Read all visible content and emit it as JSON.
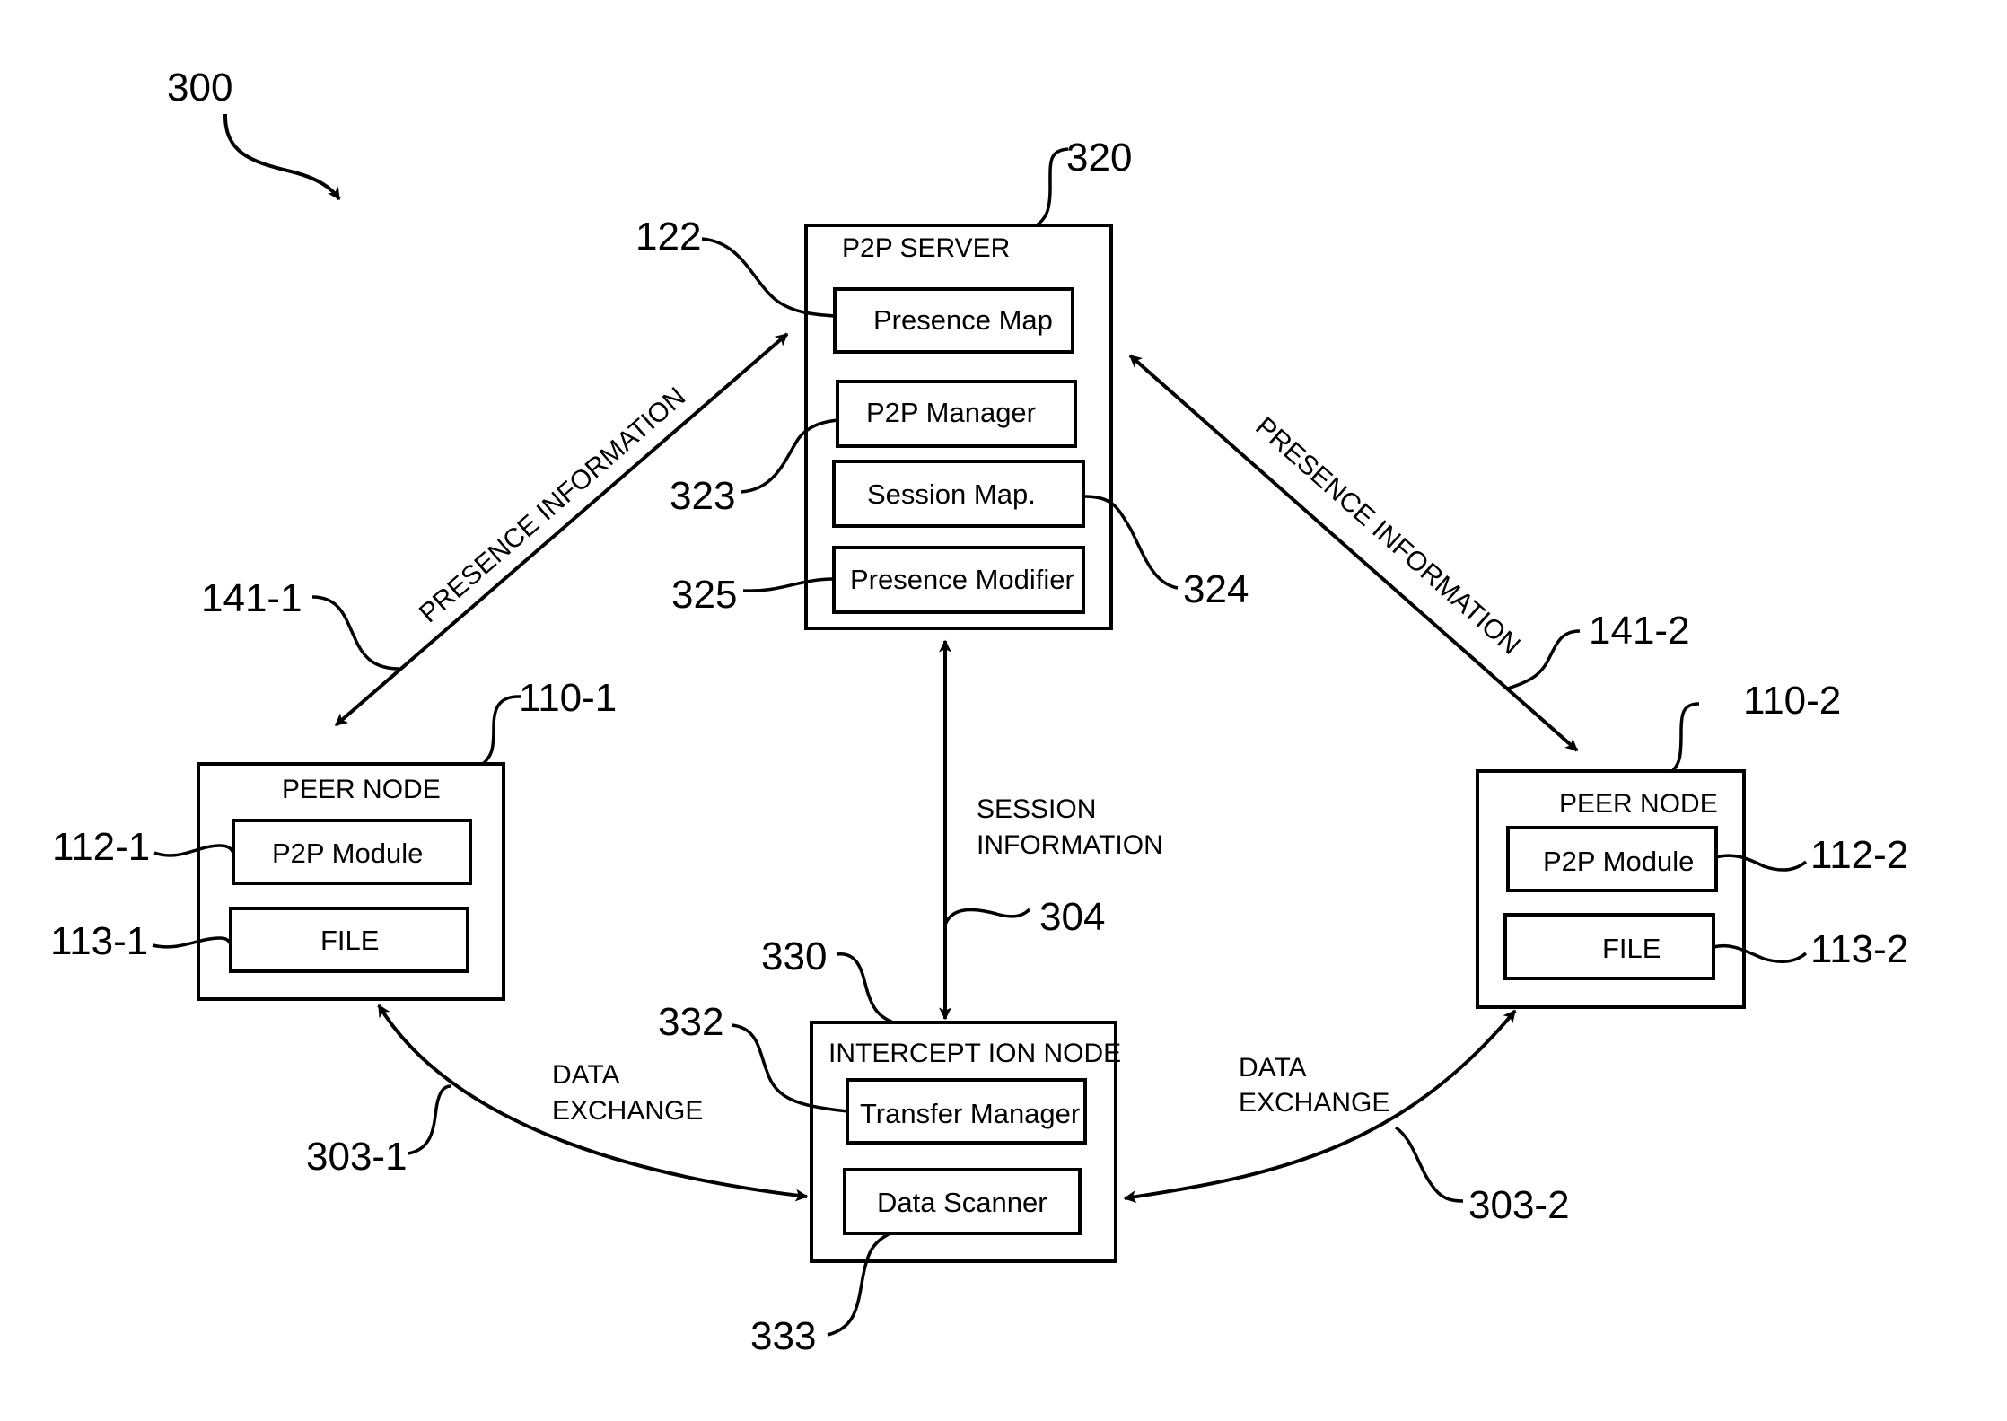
{
  "figure": {
    "ref": "300",
    "server": {
      "ref": "320",
      "title": "P2P SERVER",
      "components": [
        {
          "ref": "122",
          "label": "Presence Map"
        },
        {
          "ref": "323",
          "label": "P2P Manager"
        },
        {
          "ref": "324",
          "label": "Session Map."
        },
        {
          "ref": "325",
          "label": "Presence Modifier"
        }
      ]
    },
    "peer_left": {
      "ref": "110-1",
      "title": "PEER NODE",
      "components": [
        {
          "ref": "112-1",
          "label": "P2P Module"
        },
        {
          "ref": "113-1",
          "label": "FILE"
        }
      ]
    },
    "peer_right": {
      "ref": "110-2",
      "title": "PEER NODE",
      "components": [
        {
          "ref": "112-2",
          "label": "P2P Module"
        },
        {
          "ref": "113-2",
          "label": "FILE"
        }
      ]
    },
    "intercept": {
      "ref": "330",
      "title": "INTERCEPT ION NODE",
      "components": [
        {
          "ref": "332",
          "label": "Transfer Manager"
        },
        {
          "ref": "333",
          "label": "Data Scanner"
        }
      ]
    },
    "links": {
      "presence_left": {
        "ref": "141-1",
        "label": "PRESENCE INFORMATION"
      },
      "presence_right": {
        "ref": "141-2",
        "label": "PRESENCE INFORMATION"
      },
      "session": {
        "ref": "304",
        "label_line1": "SESSION",
        "label_line2": "INFORMATION"
      },
      "data_left": {
        "ref": "303-1",
        "label_line1": "DATA",
        "label_line2": "EXCHANGE"
      },
      "data_right": {
        "ref": "303-2",
        "label_line1": "DATA",
        "label_line2": "EXCHANGE"
      }
    }
  }
}
